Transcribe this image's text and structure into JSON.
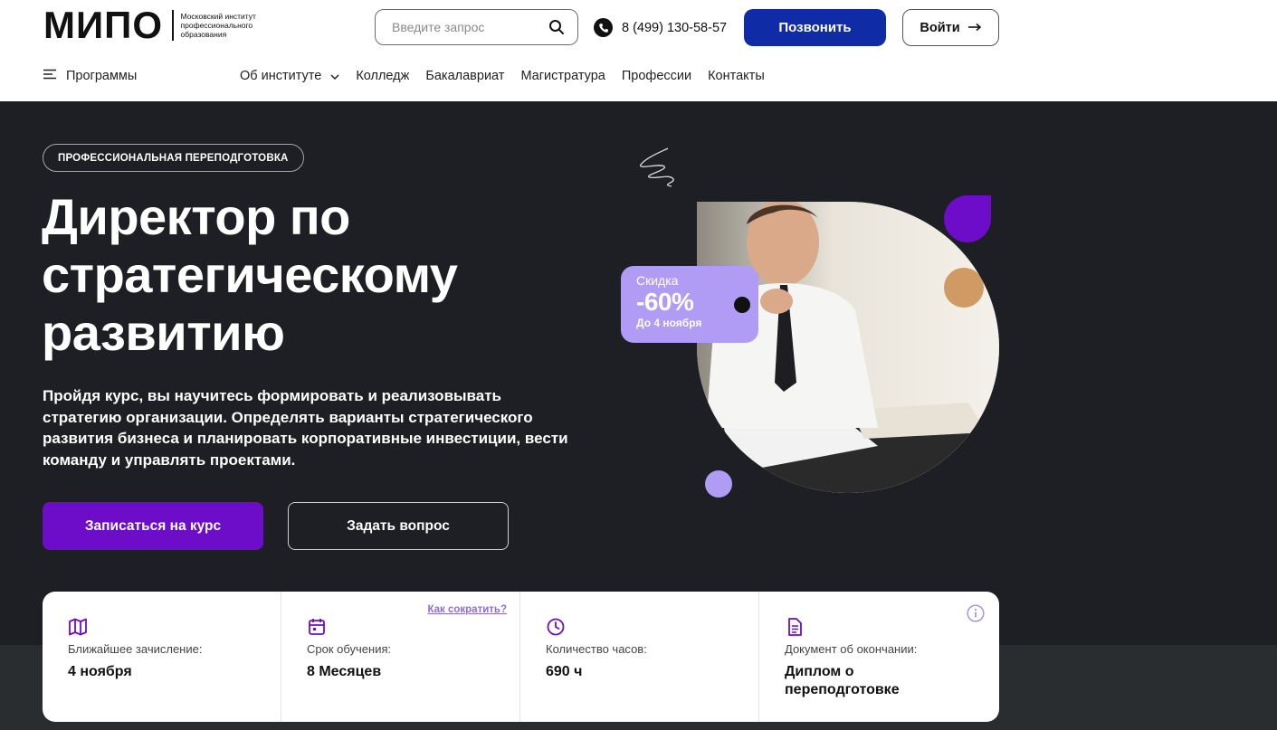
{
  "header": {
    "logo": {
      "wordmark": "МИПО",
      "subtitle": "Московский институт профессионального образования"
    },
    "search": {
      "placeholder": "Введите запрос",
      "icon": "search-icon"
    },
    "phone": {
      "number": "8 (499) 130-58-57",
      "icon": "phone-icon"
    },
    "call_label": "Позвонить",
    "login_label": "Войти",
    "login_icon": "arrow-right-icon",
    "colors": {
      "call_button": "#0f2ba5"
    }
  },
  "nav": {
    "programs_label": "Программы",
    "programs_icon": "menu-icon",
    "items": [
      {
        "label": "Об институте",
        "has_dropdown": true
      },
      {
        "label": "Колледж"
      },
      {
        "label": "Бакалавриат"
      },
      {
        "label": "Магистратура"
      },
      {
        "label": "Профессии"
      },
      {
        "label": "Контакты"
      }
    ]
  },
  "hero": {
    "tag": "ПРОФЕССИОНАЛЬНАЯ ПЕРЕПОДГОТОВКА",
    "title_lines": [
      "Директор по",
      "стратегическому",
      "развитию"
    ],
    "description_lines": [
      "Пройдя курс, вы научитесь формировать и реализовывать",
      "стратегию организации. Определять варианты стратегического",
      "развития бизнеса и планировать корпоративные инвестиции, вести",
      "команду и управлять проектами."
    ],
    "enroll_label": "Записаться на курс",
    "ask_label": "Задать вопрос",
    "discount": {
      "label": "Скидка",
      "value": "-60%",
      "until": "До 4 ноября"
    },
    "colors": {
      "background": "#1d1f24",
      "accent": "#6d0cc9",
      "lilac": "#b19cf5"
    }
  },
  "info_card": {
    "shorten_link": "Как сократить?",
    "cells": [
      {
        "icon": "map-icon",
        "label": "Ближайшее зачисление:",
        "value": "4 ноября"
      },
      {
        "icon": "calendar-icon",
        "label": "Срок обучения:",
        "value": "8 Месяцев"
      },
      {
        "icon": "clock-icon",
        "label": "Количество часов:",
        "value": "690 ч"
      },
      {
        "icon": "document-icon",
        "label": "Документ об окончании:",
        "value_lines": [
          "Диплом о",
          "переподготовке"
        ]
      }
    ],
    "info_icon": "info-icon"
  }
}
